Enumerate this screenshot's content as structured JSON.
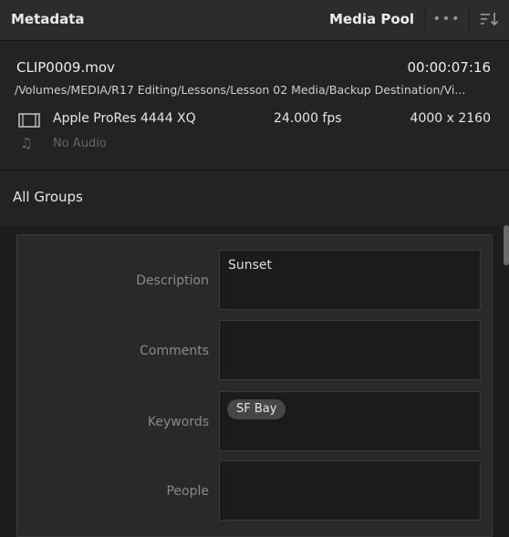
{
  "header": {
    "panel_title": "Metadata",
    "media_pool_label": "Media Pool",
    "options_label": "•••",
    "sort_icon": "sort-icon"
  },
  "clip": {
    "name": "CLIP0009.mov",
    "timecode": "00:00:07:16",
    "path": "/Volumes/MEDIA/R17 Editing/Lessons/Lesson 02 Media/Backup Destination/Vi...",
    "codec": "Apple ProRes 4444 XQ",
    "fps": "24.000 fps",
    "resolution": "4000 x 2160",
    "audio": "No Audio",
    "video_icon": "film-icon",
    "audio_icon": "music-note-icon"
  },
  "groups": {
    "label": "All Groups"
  },
  "fields": {
    "description": {
      "label": "Description",
      "value": "Sunset"
    },
    "comments": {
      "label": "Comments",
      "value": ""
    },
    "keywords": {
      "label": "Keywords",
      "tags": [
        "SF Bay"
      ]
    },
    "people": {
      "label": "People",
      "value": ""
    }
  }
}
